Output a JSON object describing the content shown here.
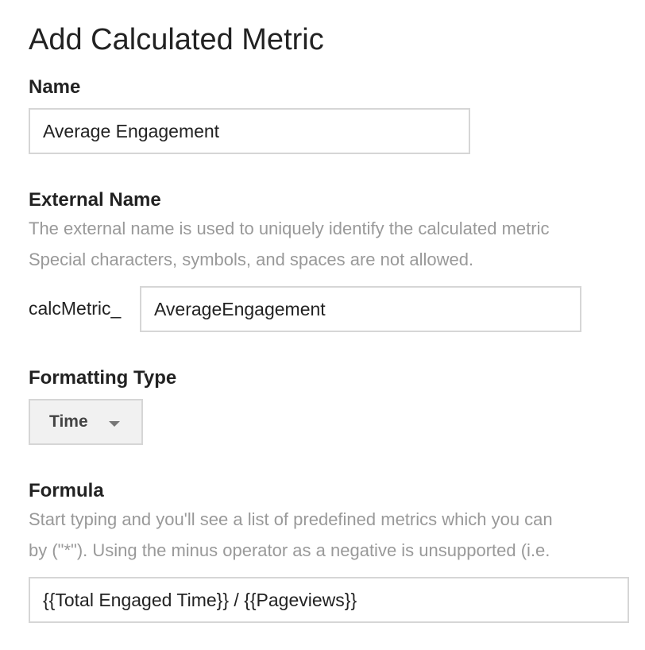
{
  "page": {
    "title": "Add Calculated Metric"
  },
  "name_section": {
    "label": "Name",
    "value": "Average Engagement"
  },
  "external_name_section": {
    "label": "External Name",
    "help_line1": "The external name is used to uniquely identify the calculated metric",
    "help_line2": "Special characters, symbols, and spaces are not allowed.",
    "prefix": "calcMetric_",
    "value": "AverageEngagement"
  },
  "formatting_section": {
    "label": "Formatting Type",
    "selected": "Time",
    "icon": "chevron-down-icon"
  },
  "formula_section": {
    "label": "Formula",
    "help_line1": "Start typing and you'll see a list of predefined metrics which you can",
    "help_line2": "by (\"*\"). Using the minus operator as a negative is unsupported (i.e.",
    "value": "{{Total Engaged Time}} / {{Pageviews}}"
  }
}
